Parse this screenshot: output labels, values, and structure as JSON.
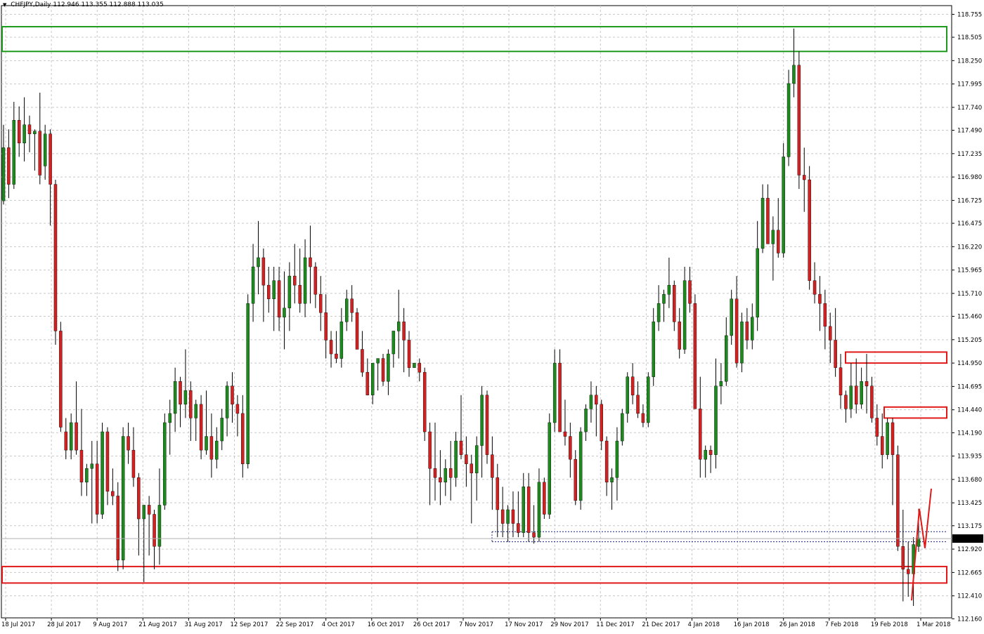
{
  "header": {
    "menu_arrow": "▼",
    "symbol": "CHFJPY,Daily",
    "ohlc": "112.946 113.355 112.888 113.035"
  },
  "chart_data": {
    "type": "candlestick",
    "symbol": "CHFJPY",
    "timeframe": "Daily",
    "ylim": [
      112.17,
      118.85
    ],
    "grid": true,
    "current_price": "113.035",
    "y_ticks": [
      "118.755",
      "118.505",
      "118.250",
      "117.995",
      "117.740",
      "117.490",
      "117.235",
      "116.980",
      "116.725",
      "116.475",
      "116.220",
      "115.965",
      "115.710",
      "115.460",
      "115.205",
      "114.950",
      "114.695",
      "114.440",
      "114.190",
      "113.935",
      "113.680",
      "113.425",
      "113.175",
      "112.920",
      "112.665",
      "112.410",
      "112.160"
    ],
    "x_ticks": [
      "18 Jul 2017",
      "28 Jul 2017",
      "9 Aug 2017",
      "21 Aug 2017",
      "31 Aug 2017",
      "12 Sep 2017",
      "22 Sep 2017",
      "4 Oct 2017",
      "16 Oct 2017",
      "26 Oct 2017",
      "7 Nov 2017",
      "17 Nov 2017",
      "29 Nov 2017",
      "11 Dec 2017",
      "21 Dec 2017",
      "4 Jan 2018",
      "16 Jan 2018",
      "26 Jan 2018",
      "7 Feb 2018",
      "19 Feb 2018",
      "1 Mar 2018"
    ],
    "colors": {
      "bull": "#1c8a1c",
      "bear": "#d42020",
      "wick": "#000000",
      "grid": "#c8c8c8",
      "support": "#e01818",
      "resistance": "#1e9a1e",
      "projection": "#e01818",
      "level": "#1a237e"
    },
    "candles": [
      [
        116.72,
        117.55,
        116.68,
        117.3
      ],
      [
        117.3,
        117.5,
        116.75,
        116.9
      ],
      [
        116.9,
        117.8,
        116.85,
        117.6
      ],
      [
        117.6,
        117.75,
        117.2,
        117.35
      ],
      [
        117.35,
        117.85,
        117.15,
        117.55
      ],
      [
        117.55,
        117.65,
        117.25,
        117.45
      ],
      [
        117.45,
        117.5,
        117.05,
        117.48
      ],
      [
        117.48,
        117.9,
        116.9,
        117.0
      ],
      [
        117.1,
        117.55,
        116.95,
        117.45
      ],
      [
        117.45,
        117.5,
        116.45,
        116.9
      ],
      [
        116.9,
        116.95,
        115.15,
        115.3
      ],
      [
        115.3,
        115.4,
        114.2,
        114.25
      ],
      [
        114.2,
        114.35,
        113.9,
        114.0
      ],
      [
        114.0,
        114.4,
        113.9,
        114.3
      ],
      [
        114.3,
        114.75,
        113.95,
        114.0
      ],
      [
        114.0,
        114.45,
        113.5,
        113.65
      ],
      [
        113.65,
        113.85,
        113.5,
        113.8
      ],
      [
        113.8,
        114.1,
        113.2,
        113.85
      ],
      [
        113.85,
        114.1,
        113.2,
        113.3
      ],
      [
        113.3,
        114.3,
        113.25,
        114.2
      ],
      [
        114.2,
        114.25,
        113.4,
        113.55
      ],
      [
        113.55,
        113.8,
        113.4,
        113.5
      ],
      [
        113.5,
        113.65,
        112.68,
        112.8
      ],
      [
        112.8,
        114.25,
        112.7,
        114.15
      ],
      [
        114.15,
        114.3,
        113.85,
        114.0
      ],
      [
        114.0,
        114.25,
        113.6,
        113.7
      ],
      [
        113.7,
        113.75,
        112.85,
        113.25
      ],
      [
        113.25,
        113.4,
        112.56,
        113.4
      ],
      [
        113.4,
        113.5,
        112.85,
        113.3
      ],
      [
        113.3,
        113.35,
        112.7,
        112.95
      ],
      [
        112.95,
        113.8,
        112.75,
        113.4
      ],
      [
        113.4,
        114.4,
        113.35,
        114.3
      ],
      [
        114.3,
        114.55,
        113.95,
        114.4
      ],
      [
        114.4,
        114.9,
        114.2,
        114.75
      ],
      [
        114.75,
        114.8,
        114.25,
        114.5
      ],
      [
        114.5,
        115.1,
        114.35,
        114.65
      ],
      [
        114.65,
        114.75,
        114.1,
        114.35
      ],
      [
        114.35,
        114.55,
        114.1,
        114.5
      ],
      [
        114.5,
        114.6,
        113.9,
        114.0
      ],
      [
        114.0,
        114.65,
        113.95,
        114.15
      ],
      [
        114.15,
        114.4,
        113.7,
        113.9
      ],
      [
        113.9,
        114.25,
        113.8,
        114.1
      ],
      [
        114.1,
        114.45,
        114.0,
        114.35
      ],
      [
        114.35,
        114.75,
        114.15,
        114.7
      ],
      [
        114.7,
        114.85,
        114.3,
        114.5
      ],
      [
        114.5,
        114.6,
        114.15,
        114.4
      ],
      [
        114.4,
        114.6,
        113.7,
        113.85
      ],
      [
        113.85,
        115.7,
        113.8,
        115.6
      ],
      [
        115.6,
        116.25,
        115.4,
        116.0
      ],
      [
        116.0,
        116.5,
        115.7,
        116.1
      ],
      [
        116.1,
        116.2,
        115.4,
        115.8
      ],
      [
        115.8,
        116.0,
        115.5,
        115.65
      ],
      [
        115.65,
        116.0,
        115.3,
        115.85
      ],
      [
        115.85,
        116.0,
        115.3,
        115.45
      ],
      [
        115.45,
        115.95,
        115.1,
        115.55
      ],
      [
        115.55,
        116.05,
        115.3,
        115.9
      ],
      [
        115.9,
        116.25,
        115.6,
        115.8
      ],
      [
        115.8,
        116.2,
        115.5,
        115.6
      ],
      [
        115.6,
        116.3,
        115.45,
        116.1
      ],
      [
        116.1,
        116.45,
        115.6,
        116.0
      ],
      [
        116.0,
        116.05,
        115.55,
        115.7
      ],
      [
        115.7,
        115.9,
        115.3,
        115.5
      ],
      [
        115.5,
        115.7,
        115.0,
        115.2
      ],
      [
        115.2,
        115.3,
        114.9,
        115.05
      ],
      [
        115.05,
        115.3,
        114.95,
        115.0
      ],
      [
        115.0,
        115.55,
        114.9,
        115.4
      ],
      [
        115.4,
        115.75,
        115.3,
        115.65
      ],
      [
        115.65,
        115.8,
        115.4,
        115.5
      ],
      [
        115.5,
        115.55,
        115.2,
        115.1
      ],
      [
        115.1,
        115.3,
        114.8,
        114.85
      ],
      [
        114.85,
        115.0,
        114.6,
        114.6
      ],
      [
        114.6,
        114.95,
        114.5,
        114.95
      ],
      [
        114.95,
        115.0,
        114.65,
        115.0
      ],
      [
        115.0,
        115.05,
        114.7,
        114.75
      ],
      [
        114.75,
        115.1,
        114.6,
        115.05
      ],
      [
        115.05,
        115.3,
        114.9,
        115.3
      ],
      [
        115.3,
        115.75,
        115.0,
        115.4
      ],
      [
        115.4,
        115.55,
        114.85,
        115.2
      ],
      [
        115.2,
        115.3,
        114.8,
        114.9
      ],
      [
        114.9,
        114.95,
        114.9,
        114.95
      ],
      [
        114.95,
        115.0,
        114.75,
        114.85
      ],
      [
        114.85,
        114.9,
        114.1,
        114.2
      ],
      [
        114.2,
        114.3,
        113.4,
        113.8
      ],
      [
        113.8,
        114.3,
        113.45,
        113.7
      ],
      [
        113.7,
        114.0,
        113.4,
        113.65
      ],
      [
        113.65,
        113.9,
        113.5,
        113.8
      ],
      [
        113.8,
        114.1,
        113.45,
        113.7
      ],
      [
        113.7,
        114.2,
        113.6,
        114.1
      ],
      [
        114.1,
        114.6,
        113.9,
        113.95
      ],
      [
        113.95,
        114.15,
        113.6,
        113.85
      ],
      [
        113.85,
        113.95,
        113.2,
        113.75
      ],
      [
        113.75,
        114.15,
        113.45,
        114.05
      ],
      [
        114.05,
        114.7,
        113.7,
        114.6
      ],
      [
        114.6,
        114.65,
        113.85,
        113.95
      ],
      [
        113.95,
        114.15,
        113.35,
        113.7
      ],
      [
        113.7,
        113.85,
        113.05,
        113.35
      ],
      [
        113.35,
        113.6,
        113.05,
        113.2
      ],
      [
        113.2,
        113.4,
        113.0,
        113.35
      ],
      [
        113.35,
        113.55,
        113.05,
        113.2
      ],
      [
        113.2,
        113.55,
        113.05,
        113.1
      ],
      [
        113.1,
        113.75,
        113.05,
        113.6
      ],
      [
        113.6,
        113.75,
        113.0,
        113.1
      ],
      [
        113.1,
        113.4,
        112.98,
        113.05
      ],
      [
        113.05,
        113.8,
        113.0,
        113.65
      ],
      [
        113.65,
        113.7,
        113.25,
        113.3
      ],
      [
        113.3,
        114.4,
        113.25,
        114.3
      ],
      [
        114.3,
        115.1,
        114.2,
        114.95
      ],
      [
        114.95,
        115.1,
        114.35,
        114.2
      ],
      [
        114.2,
        114.55,
        114.05,
        114.15
      ],
      [
        114.15,
        114.3,
        113.7,
        113.9
      ],
      [
        113.9,
        114.0,
        113.4,
        113.45
      ],
      [
        113.45,
        114.25,
        113.35,
        114.2
      ],
      [
        114.2,
        114.5,
        114.1,
        114.45
      ],
      [
        114.45,
        114.75,
        114.3,
        114.6
      ],
      [
        114.6,
        114.7,
        114.15,
        114.5
      ],
      [
        114.5,
        114.55,
        114.0,
        114.1
      ],
      [
        114.1,
        114.15,
        113.5,
        113.65
      ],
      [
        113.65,
        113.8,
        113.35,
        113.7
      ],
      [
        113.7,
        114.25,
        113.45,
        114.1
      ],
      [
        114.1,
        114.45,
        114.05,
        114.4
      ],
      [
        114.4,
        114.85,
        114.3,
        114.8
      ],
      [
        114.8,
        114.95,
        114.5,
        114.6
      ],
      [
        114.6,
        114.75,
        114.35,
        114.4
      ],
      [
        114.4,
        114.5,
        114.25,
        114.3
      ],
      [
        114.3,
        114.85,
        114.25,
        114.8
      ],
      [
        114.8,
        115.55,
        114.7,
        115.4
      ],
      [
        115.4,
        115.8,
        115.3,
        115.6
      ],
      [
        115.6,
        115.75,
        115.4,
        115.7
      ],
      [
        115.7,
        116.1,
        115.55,
        115.8
      ],
      [
        115.8,
        115.85,
        115.3,
        115.4
      ],
      [
        115.4,
        115.55,
        115.0,
        115.1
      ],
      [
        115.1,
        116.0,
        115.05,
        115.85
      ],
      [
        115.85,
        116.0,
        115.5,
        115.6
      ],
      [
        115.6,
        115.7,
        114.5,
        114.45
      ],
      [
        114.45,
        114.8,
        113.7,
        113.9
      ],
      [
        113.9,
        114.05,
        113.7,
        114.0
      ],
      [
        114.0,
        114.05,
        113.75,
        113.95
      ],
      [
        113.95,
        115.0,
        113.8,
        114.7
      ],
      [
        114.7,
        114.95,
        114.5,
        114.75
      ],
      [
        114.75,
        115.45,
        114.7,
        115.25
      ],
      [
        115.25,
        115.75,
        115.15,
        115.65
      ],
      [
        115.65,
        115.9,
        114.9,
        114.95
      ],
      [
        114.95,
        115.5,
        114.85,
        115.4
      ],
      [
        115.4,
        115.55,
        115.1,
        115.2
      ],
      [
        115.2,
        115.6,
        115.1,
        115.45
      ],
      [
        115.45,
        116.5,
        115.3,
        116.2
      ],
      [
        116.2,
        116.9,
        116.15,
        116.75
      ],
      [
        116.75,
        116.9,
        116.3,
        116.25
      ],
      [
        116.25,
        116.55,
        115.85,
        116.4
      ],
      [
        116.4,
        116.75,
        116.1,
        116.15
      ],
      [
        116.15,
        117.35,
        116.1,
        117.2
      ],
      [
        117.2,
        118.15,
        117.1,
        118.0
      ],
      [
        118.0,
        118.6,
        117.85,
        118.2
      ],
      [
        118.2,
        118.35,
        116.85,
        117.0
      ],
      [
        117.0,
        117.3,
        116.6,
        116.95
      ],
      [
        116.95,
        117.1,
        115.75,
        115.85
      ],
      [
        115.85,
        116.05,
        115.6,
        115.7
      ],
      [
        115.7,
        115.9,
        115.3,
        115.6
      ],
      [
        115.6,
        115.75,
        115.1,
        115.35
      ],
      [
        115.35,
        115.5,
        114.95,
        115.2
      ],
      [
        115.2,
        115.55,
        114.8,
        114.9
      ],
      [
        114.9,
        115.05,
        114.45,
        114.6
      ],
      [
        114.6,
        114.65,
        114.3,
        114.45
      ],
      [
        114.45,
        114.95,
        114.35,
        114.7
      ],
      [
        114.7,
        115.0,
        114.4,
        114.5
      ],
      [
        114.5,
        114.9,
        114.45,
        114.75
      ],
      [
        114.75,
        115.05,
        114.4,
        114.7
      ],
      [
        114.7,
        114.8,
        114.3,
        114.35
      ],
      [
        114.35,
        114.5,
        114.05,
        114.15
      ],
      [
        114.15,
        114.4,
        113.8,
        113.95
      ],
      [
        113.95,
        114.35,
        113.9,
        114.3
      ],
      [
        114.3,
        114.35,
        113.4,
        113.95
      ],
      [
        113.95,
        114.05,
        112.9,
        112.95
      ],
      [
        112.95,
        113.35,
        112.35,
        112.7
      ],
      [
        112.7,
        113.0,
        112.4,
        112.65
      ],
      [
        112.65,
        113.05,
        112.3,
        112.97
      ],
      [
        112.95,
        113.36,
        112.89,
        113.04
      ]
    ]
  }
}
